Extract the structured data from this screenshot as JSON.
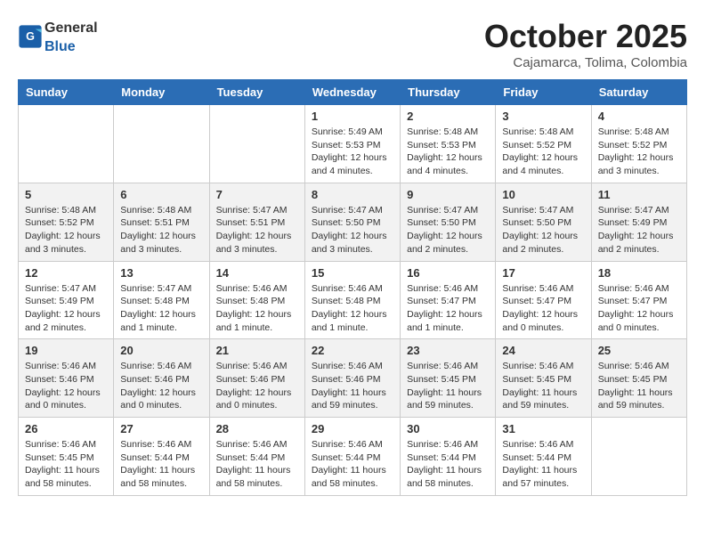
{
  "header": {
    "logo_general": "General",
    "logo_blue": "Blue",
    "month_title": "October 2025",
    "subtitle": "Cajamarca, Tolima, Colombia"
  },
  "days_of_week": [
    "Sunday",
    "Monday",
    "Tuesday",
    "Wednesday",
    "Thursday",
    "Friday",
    "Saturday"
  ],
  "weeks": [
    [
      {
        "day": "",
        "info": ""
      },
      {
        "day": "",
        "info": ""
      },
      {
        "day": "",
        "info": ""
      },
      {
        "day": "1",
        "info": "Sunrise: 5:49 AM\nSunset: 5:53 PM\nDaylight: 12 hours\nand 4 minutes."
      },
      {
        "day": "2",
        "info": "Sunrise: 5:48 AM\nSunset: 5:53 PM\nDaylight: 12 hours\nand 4 minutes."
      },
      {
        "day": "3",
        "info": "Sunrise: 5:48 AM\nSunset: 5:52 PM\nDaylight: 12 hours\nand 4 minutes."
      },
      {
        "day": "4",
        "info": "Sunrise: 5:48 AM\nSunset: 5:52 PM\nDaylight: 12 hours\nand 3 minutes."
      }
    ],
    [
      {
        "day": "5",
        "info": "Sunrise: 5:48 AM\nSunset: 5:52 PM\nDaylight: 12 hours\nand 3 minutes."
      },
      {
        "day": "6",
        "info": "Sunrise: 5:48 AM\nSunset: 5:51 PM\nDaylight: 12 hours\nand 3 minutes."
      },
      {
        "day": "7",
        "info": "Sunrise: 5:47 AM\nSunset: 5:51 PM\nDaylight: 12 hours\nand 3 minutes."
      },
      {
        "day": "8",
        "info": "Sunrise: 5:47 AM\nSunset: 5:50 PM\nDaylight: 12 hours\nand 3 minutes."
      },
      {
        "day": "9",
        "info": "Sunrise: 5:47 AM\nSunset: 5:50 PM\nDaylight: 12 hours\nand 2 minutes."
      },
      {
        "day": "10",
        "info": "Sunrise: 5:47 AM\nSunset: 5:50 PM\nDaylight: 12 hours\nand 2 minutes."
      },
      {
        "day": "11",
        "info": "Sunrise: 5:47 AM\nSunset: 5:49 PM\nDaylight: 12 hours\nand 2 minutes."
      }
    ],
    [
      {
        "day": "12",
        "info": "Sunrise: 5:47 AM\nSunset: 5:49 PM\nDaylight: 12 hours\nand 2 minutes."
      },
      {
        "day": "13",
        "info": "Sunrise: 5:47 AM\nSunset: 5:48 PM\nDaylight: 12 hours\nand 1 minute."
      },
      {
        "day": "14",
        "info": "Sunrise: 5:46 AM\nSunset: 5:48 PM\nDaylight: 12 hours\nand 1 minute."
      },
      {
        "day": "15",
        "info": "Sunrise: 5:46 AM\nSunset: 5:48 PM\nDaylight: 12 hours\nand 1 minute."
      },
      {
        "day": "16",
        "info": "Sunrise: 5:46 AM\nSunset: 5:47 PM\nDaylight: 12 hours\nand 1 minute."
      },
      {
        "day": "17",
        "info": "Sunrise: 5:46 AM\nSunset: 5:47 PM\nDaylight: 12 hours\nand 0 minutes."
      },
      {
        "day": "18",
        "info": "Sunrise: 5:46 AM\nSunset: 5:47 PM\nDaylight: 12 hours\nand 0 minutes."
      }
    ],
    [
      {
        "day": "19",
        "info": "Sunrise: 5:46 AM\nSunset: 5:46 PM\nDaylight: 12 hours\nand 0 minutes."
      },
      {
        "day": "20",
        "info": "Sunrise: 5:46 AM\nSunset: 5:46 PM\nDaylight: 12 hours\nand 0 minutes."
      },
      {
        "day": "21",
        "info": "Sunrise: 5:46 AM\nSunset: 5:46 PM\nDaylight: 12 hours\nand 0 minutes."
      },
      {
        "day": "22",
        "info": "Sunrise: 5:46 AM\nSunset: 5:46 PM\nDaylight: 11 hours\nand 59 minutes."
      },
      {
        "day": "23",
        "info": "Sunrise: 5:46 AM\nSunset: 5:45 PM\nDaylight: 11 hours\nand 59 minutes."
      },
      {
        "day": "24",
        "info": "Sunrise: 5:46 AM\nSunset: 5:45 PM\nDaylight: 11 hours\nand 59 minutes."
      },
      {
        "day": "25",
        "info": "Sunrise: 5:46 AM\nSunset: 5:45 PM\nDaylight: 11 hours\nand 59 minutes."
      }
    ],
    [
      {
        "day": "26",
        "info": "Sunrise: 5:46 AM\nSunset: 5:45 PM\nDaylight: 11 hours\nand 58 minutes."
      },
      {
        "day": "27",
        "info": "Sunrise: 5:46 AM\nSunset: 5:44 PM\nDaylight: 11 hours\nand 58 minutes."
      },
      {
        "day": "28",
        "info": "Sunrise: 5:46 AM\nSunset: 5:44 PM\nDaylight: 11 hours\nand 58 minutes."
      },
      {
        "day": "29",
        "info": "Sunrise: 5:46 AM\nSunset: 5:44 PM\nDaylight: 11 hours\nand 58 minutes."
      },
      {
        "day": "30",
        "info": "Sunrise: 5:46 AM\nSunset: 5:44 PM\nDaylight: 11 hours\nand 58 minutes."
      },
      {
        "day": "31",
        "info": "Sunrise: 5:46 AM\nSunset: 5:44 PM\nDaylight: 11 hours\nand 57 minutes."
      },
      {
        "day": "",
        "info": ""
      }
    ]
  ]
}
